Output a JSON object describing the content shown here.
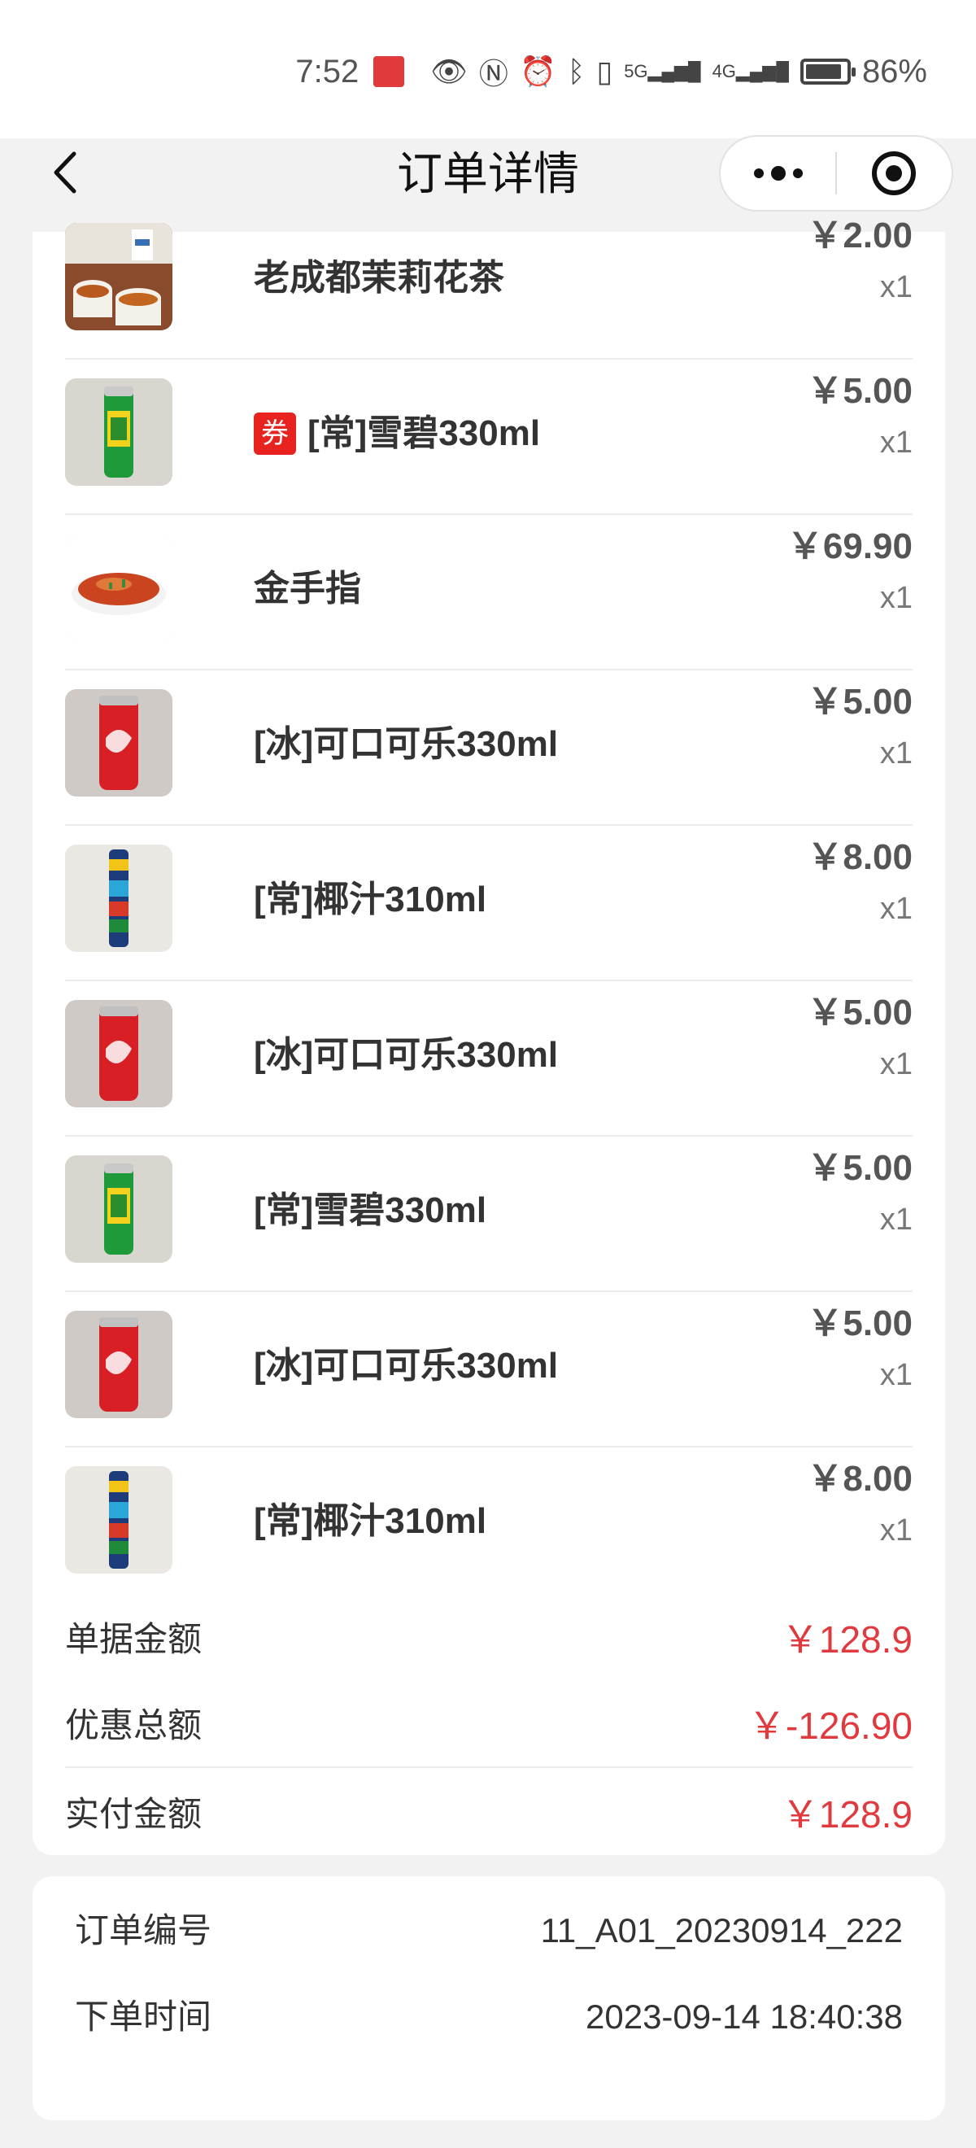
{
  "status_bar": {
    "time": "7:52",
    "network": "5G",
    "network2": "4G",
    "battery": "86%",
    "battery_level": 0.86
  },
  "nav": {
    "title": "订单详情"
  },
  "items": [
    {
      "name": "老成都茉莉花茶",
      "price": "￥2.00",
      "qty": "x1",
      "coupon": "",
      "thumb": "tea-image"
    },
    {
      "name": "[常]雪碧330ml",
      "price": "￥5.00",
      "qty": "x1",
      "coupon": "券",
      "thumb": "sprite-can-image"
    },
    {
      "name": "金手指",
      "price": "￥69.90",
      "qty": "x1",
      "coupon": "",
      "thumb": "dish-image"
    },
    {
      "name": "[冰]可口可乐330ml",
      "price": "￥5.00",
      "qty": "x1",
      "coupon": "",
      "thumb": "coke-can-image"
    },
    {
      "name": "[常]椰汁310ml",
      "price": "￥8.00",
      "qty": "x1",
      "coupon": "",
      "thumb": "coconut-can-image"
    },
    {
      "name": "[冰]可口可乐330ml",
      "price": "￥5.00",
      "qty": "x1",
      "coupon": "",
      "thumb": "coke-can-image"
    },
    {
      "name": "[常]雪碧330ml",
      "price": "￥5.00",
      "qty": "x1",
      "coupon": "",
      "thumb": "sprite-can-image"
    },
    {
      "name": "[冰]可口可乐330ml",
      "price": "￥5.00",
      "qty": "x1",
      "coupon": "",
      "thumb": "coke-can-image"
    },
    {
      "name": "[常]椰汁310ml",
      "price": "￥8.00",
      "qty": "x1",
      "coupon": "",
      "thumb": "coconut-can-image"
    }
  ],
  "summary": {
    "bill_label": "单据金额",
    "bill_value": "￥128.9",
    "discount_label": "优惠总额",
    "discount_value": "￥-126.90",
    "paid_label": "实付金额",
    "paid_value": "￥128.9"
  },
  "order_info": {
    "number_label": "订单编号",
    "number_value": "11_A01_20230914_222",
    "time_label": "下单时间",
    "time_value": "2023-09-14 18:40:38"
  },
  "colors": {
    "accent_red": "#e0393e",
    "coupon_red": "#e8231f"
  }
}
